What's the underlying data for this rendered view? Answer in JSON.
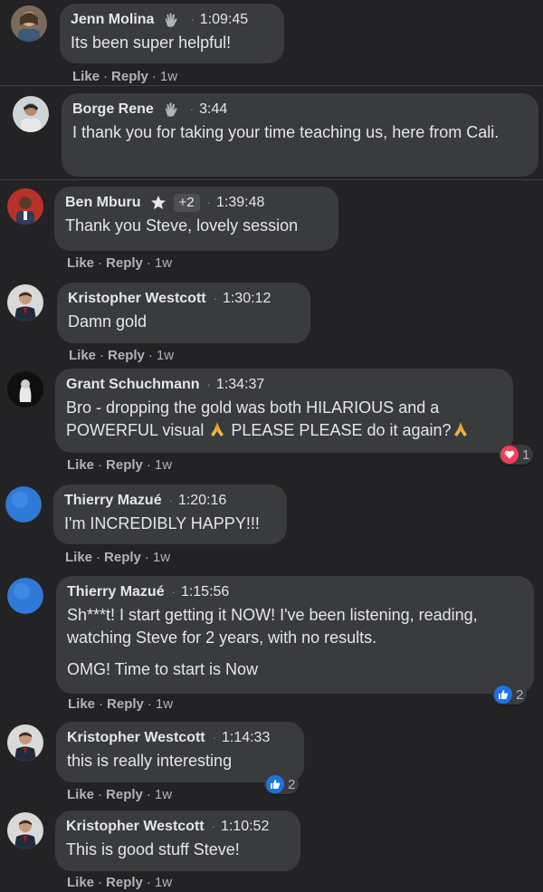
{
  "actions": {
    "like": "Like",
    "reply": "Reply",
    "dot": "·",
    "age": "1w"
  },
  "comments": [
    {
      "name": "Jenn Molina",
      "badge": "wave-icon",
      "time": "1:09:45",
      "text": [
        "Its been super helpful!"
      ]
    },
    {
      "name": "Borge Rene",
      "badge": "wave-icon",
      "time": "3:44",
      "text": [
        "I thank you for taking your time teaching us, here from Cali."
      ]
    },
    {
      "name": "Ben Mburu",
      "badge": "star-icon",
      "plus": "+2",
      "time": "1:39:48",
      "text": [
        "Thank you Steve, lovely session"
      ]
    },
    {
      "name": "Kristopher Westcott",
      "time": "1:30:12",
      "text": [
        "Damn gold"
      ]
    },
    {
      "name": "Grant Schuchmann",
      "time": "1:34:37",
      "text": [
        "Bro - dropping the gold was both HILARIOUS and a POWERFUL visual",
        "PLEASE PLEASE do it again?"
      ],
      "reaction": {
        "type": "heart",
        "count": "1"
      }
    },
    {
      "name": "Thierry Mazué",
      "time": "1:20:16",
      "text": [
        "I'm INCREDIBLY HAPPY!!!"
      ]
    },
    {
      "name": "Thierry Mazué",
      "time": "1:15:56",
      "text": [
        "Sh***t! I start getting it NOW! I've been listening, reading, watching Steve for 2 years, with no results.",
        "OMG! Time to start is Now"
      ],
      "reaction": {
        "type": "like",
        "count": "2"
      }
    },
    {
      "name": "Kristopher Westcott",
      "time": "1:14:33",
      "text": [
        "this is really interesting"
      ],
      "reaction": {
        "type": "like",
        "count": "2"
      }
    },
    {
      "name": "Kristopher Westcott",
      "time": "1:10:52",
      "text": [
        "This is good stuff Steve!"
      ]
    }
  ]
}
